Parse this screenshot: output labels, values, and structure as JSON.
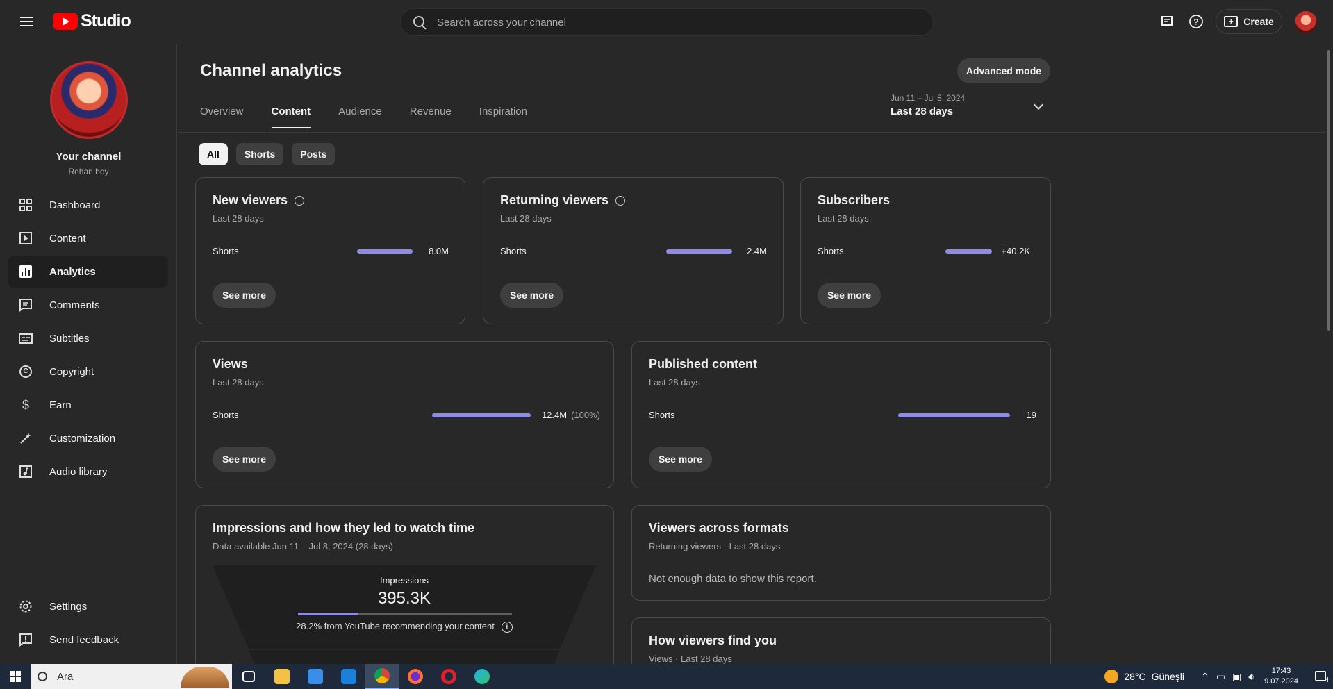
{
  "header": {
    "logo_text": "Studio",
    "search_placeholder": "Search across your channel",
    "create_label": "Create"
  },
  "sidebar": {
    "channel_name": "Your channel",
    "channel_handle": "Rehan boy",
    "items": [
      {
        "label": "Dashboard",
        "icon": "dashboard-icon"
      },
      {
        "label": "Content",
        "icon": "content-icon"
      },
      {
        "label": "Analytics",
        "icon": "analytics-icon"
      },
      {
        "label": "Comments",
        "icon": "comments-icon"
      },
      {
        "label": "Subtitles",
        "icon": "subtitles-icon"
      },
      {
        "label": "Copyright",
        "icon": "copyright-icon"
      },
      {
        "label": "Earn",
        "icon": "earn-icon"
      },
      {
        "label": "Customization",
        "icon": "customization-icon"
      },
      {
        "label": "Audio library",
        "icon": "audio-library-icon"
      }
    ],
    "bottom_items": [
      {
        "label": "Settings",
        "icon": "gear-icon"
      },
      {
        "label": "Send feedback",
        "icon": "feedback-icon"
      }
    ]
  },
  "main": {
    "title": "Channel analytics",
    "advanced_mode": "Advanced mode",
    "tabs": [
      {
        "label": "Overview"
      },
      {
        "label": "Content"
      },
      {
        "label": "Audience"
      },
      {
        "label": "Revenue"
      },
      {
        "label": "Inspiration"
      }
    ],
    "active_tab": "Content",
    "date_range": "Jun 11 – Jul 8, 2024",
    "date_label": "Last 28 days",
    "chips": [
      {
        "label": "All"
      },
      {
        "label": "Shorts"
      },
      {
        "label": "Posts"
      }
    ],
    "active_chip": "All"
  },
  "cards": {
    "new_viewers": {
      "title": "New viewers",
      "sub": "Last 28 days",
      "row_label": "Shorts",
      "value": "8.0M",
      "see_more": "See more"
    },
    "returning_viewers": {
      "title": "Returning viewers",
      "sub": "Last 28 days",
      "row_label": "Shorts",
      "value": "2.4M",
      "see_more": "See more"
    },
    "subscribers": {
      "title": "Subscribers",
      "sub": "Last 28 days",
      "row_label": "Shorts",
      "value": "+40.2K",
      "see_more": "See more"
    },
    "views": {
      "title": "Views",
      "sub": "Last 28 days",
      "row_label": "Shorts",
      "value": "12.4M",
      "pct": "(100%)",
      "see_more": "See more"
    },
    "published": {
      "title": "Published content",
      "sub": "Last 28 days",
      "row_label": "Shorts",
      "value": "19",
      "see_more": "See more"
    },
    "impressions": {
      "title": "Impressions and how they led to watch time",
      "sub": "Data available Jun 11 – Jul 8, 2024 (28 days)",
      "funnel_label": "Impressions",
      "funnel_value": "395.3K",
      "recommend_fraction": 0.282,
      "note": "28.2% from YouTube recommending your content"
    },
    "formats": {
      "title": "Viewers across formats",
      "sub": "Returning viewers · Last 28 days",
      "empty": "Not enough data to show this report."
    },
    "find_you": {
      "title": "How viewers find you",
      "sub": "Views · Last 28 days"
    }
  },
  "taskbar": {
    "search_text": "Ara",
    "weather": "28°C",
    "weather_desc": "Güneşli",
    "time": "17:43",
    "date": "9.07.2024",
    "notif_count": "4"
  },
  "colors": {
    "accent_bar": "#8f89e8",
    "brand_red": "#ff0000"
  }
}
